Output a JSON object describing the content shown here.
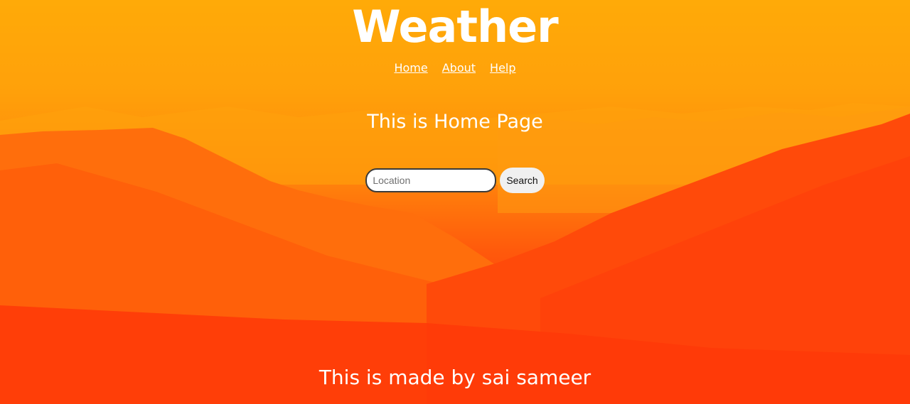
{
  "header": {
    "title": "Weather",
    "nav": [
      {
        "label": "Home"
      },
      {
        "label": "About"
      },
      {
        "label": "Help"
      }
    ]
  },
  "main": {
    "heading": "This is Home Page",
    "search": {
      "placeholder": "Location",
      "value": "",
      "button_label": "Search"
    }
  },
  "footer": {
    "text": "This is made by sai sameer"
  },
  "background": {
    "icon": "mountain-landscape-image",
    "colors": {
      "sky": "#ffaa08",
      "mid": "#ff8a0c",
      "ground": "#ff3a0a"
    }
  }
}
